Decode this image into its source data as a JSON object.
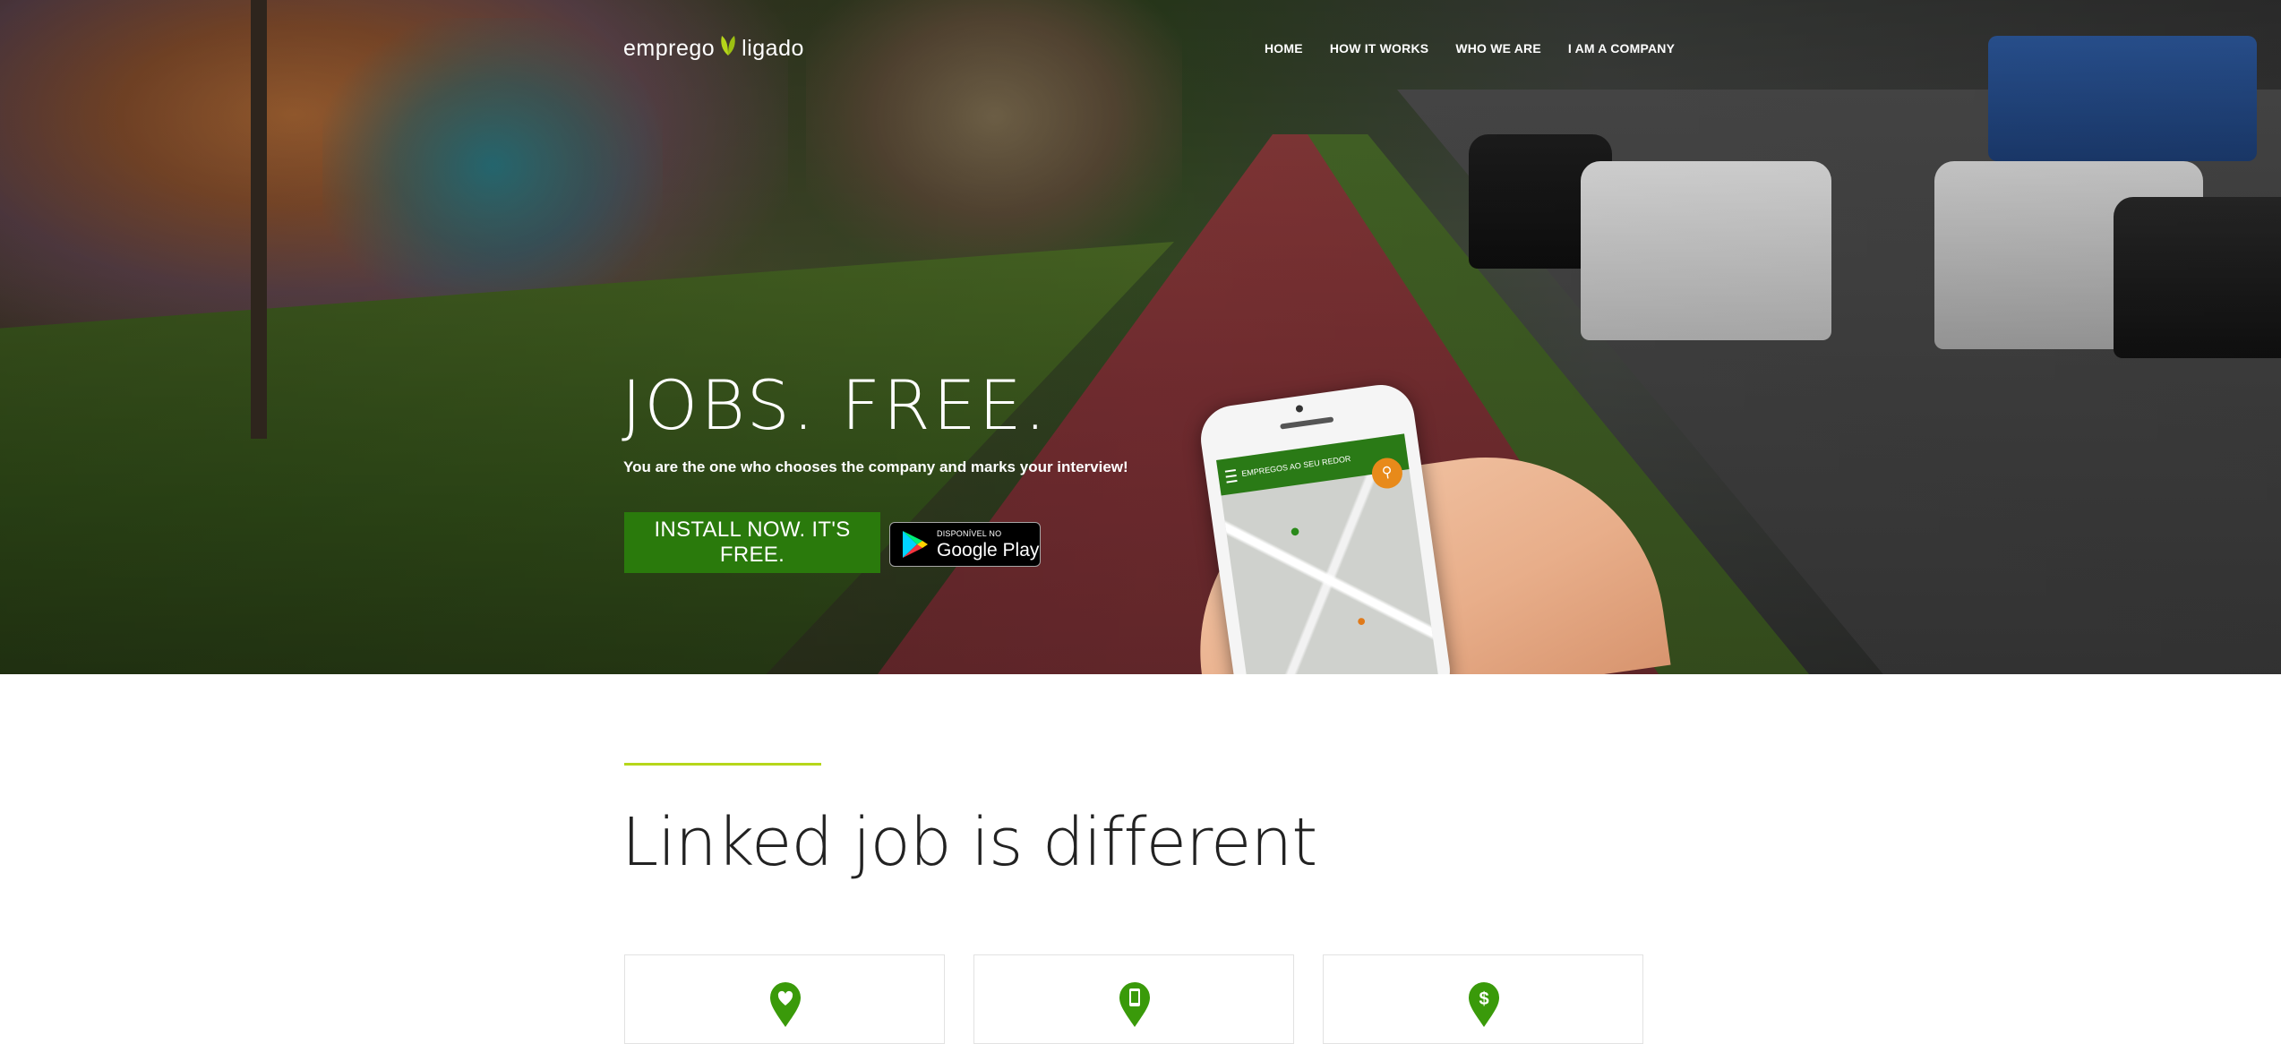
{
  "brand": {
    "logo_left": "emprego",
    "logo_right": "ligado"
  },
  "nav": {
    "items": [
      "HOME",
      "HOW IT WORKS",
      "WHO WE ARE",
      "I AM A COMPANY"
    ]
  },
  "hero": {
    "title": "JOBS. FREE.",
    "subtitle": "You are the one who chooses the company and marks your interview!",
    "install_button": "INSTALL NOW. IT'S FREE.",
    "gplay_small": "DISPONÍVEL NO",
    "gplay_big": "Google Play",
    "phone_app_bar": "EMPREGOS AO SEU REDOR"
  },
  "section": {
    "title": "Linked job is different"
  },
  "cards": [
    {
      "icon": "heart-pin-icon"
    },
    {
      "icon": "phone-pin-icon"
    },
    {
      "icon": "dollar-pin-icon"
    }
  ],
  "colors": {
    "brand_green": "#2a7a0c",
    "accent_lime": "#b6d61a",
    "icon_green": "#3a9a0a"
  }
}
